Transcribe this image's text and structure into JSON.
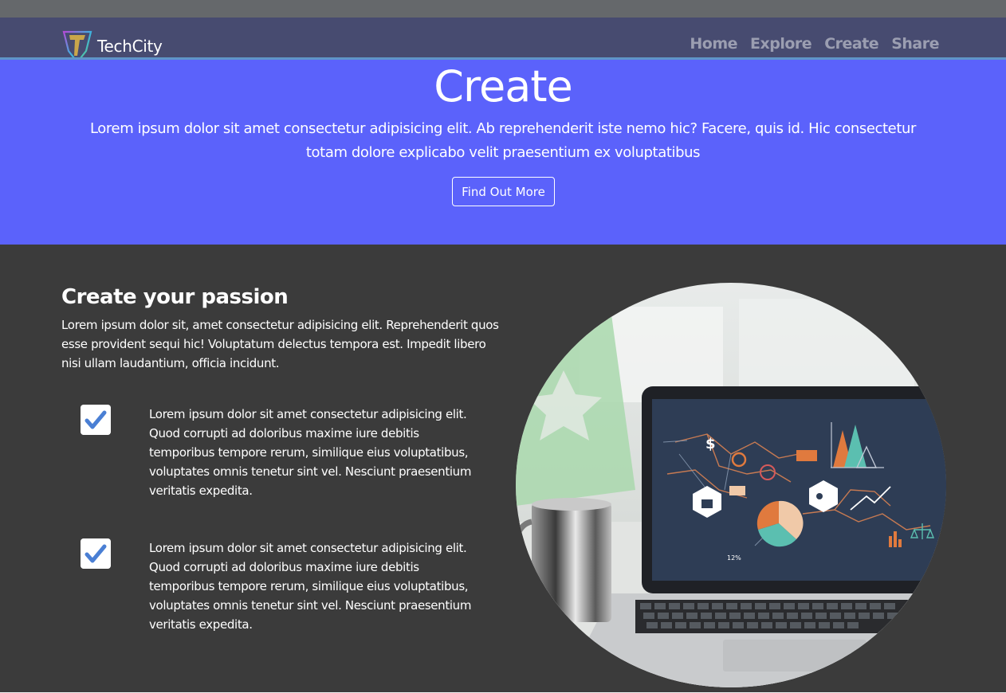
{
  "brand": {
    "name": "TechCity",
    "logo_icon": "shield-t-logo-icon"
  },
  "nav": {
    "links": [
      "Home",
      "Explore",
      "Create",
      "Share"
    ]
  },
  "hero": {
    "title": "Create",
    "text": "Lorem ipsum dolor sit amet consectetur adipisicing elit. Ab reprehenderit iste nemo hic? Facere, quis id. Hic consectetur totam dolore explicabo velit praesentium ex voluptatibus",
    "button": "Find Out More"
  },
  "section": {
    "title": "Create your passion",
    "text": "Lorem ipsum dolor sit, amet consectetur adipisicing elit. Reprehenderit quos esse provident sequi hic! Voluptatum delectus tempora est. Impedit libero nisi ullam laudantium, officia incidunt.",
    "features": [
      {
        "icon": "checkbox-checked-icon",
        "text": "Lorem ipsum dolor sit amet consectetur adipisicing elit. Quod corrupti ad doloribus maxime iure debitis temporibus tempore rerum, similique eius voluptatibus, voluptates omnis tenetur sint vel. Nesciunt praesentium veritatis expedita."
      },
      {
        "icon": "checkbox-checked-icon",
        "text": "Lorem ipsum dolor sit amet consectetur adipisicing elit. Quod corrupti ad doloribus maxime iure debitis temporibus tempore rerum, similique eius voluptatibus, voluptates omnis tenetur sint vel. Nesciunt praesentium veritatis expedita."
      }
    ],
    "image": {
      "icon": "laptop-analytics-image",
      "screen_label": "12%"
    }
  },
  "colors": {
    "hero_bg": "#5b62fb",
    "navbar_bg": "#474b70",
    "section_bg": "#3b3b3b",
    "check_blue": "#4a7fd4"
  }
}
